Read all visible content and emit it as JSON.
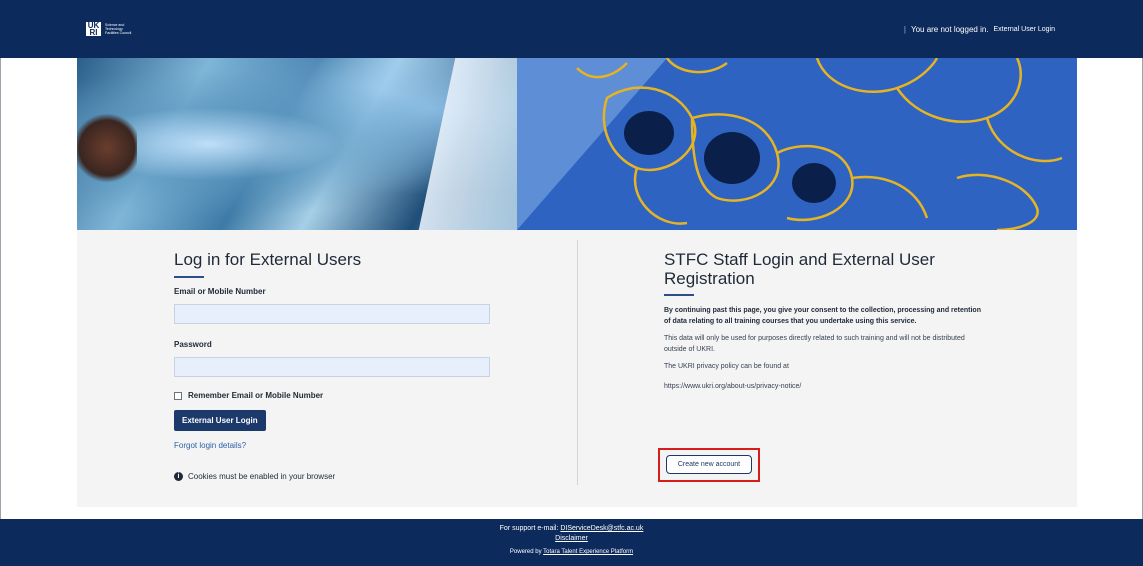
{
  "header": {
    "logo_mark": "UK RI",
    "logo_text": "Science and Technology Facilities Council",
    "separator": "|",
    "status_text": "You are not logged in.",
    "login_link": "External User Login"
  },
  "left": {
    "title": "Log in for External Users",
    "email_label": "Email or Mobile Number",
    "email_value": "",
    "password_label": "Password",
    "password_value": "",
    "remember_label": "Remember Email or Mobile Number",
    "login_button": "External User Login",
    "forgot_link": "Forgot login details?",
    "cookie_note": "Cookies must be enabled in your browser"
  },
  "right": {
    "title": "STFC Staff Login and External User Registration",
    "consent": "By continuing past this page, you give your consent to the collection, processing and retention of data relating to all training courses that you undertake using this service.",
    "para1": "This data will only be used for purposes directly related to such training and will not be distributed outside of UKRI.",
    "para2": "The UKRI privacy policy can be found at",
    "policy_url": "https://www.ukri.org/about-us/privacy-notice/",
    "create_button": "Create new account"
  },
  "footer": {
    "support_prefix": "For support e-mail:",
    "support_email": "DIServiceDesk@stfc.ac.uk",
    "disclaimer": "Disclaimer",
    "powered_prefix": "Powered by",
    "powered_link": "Totara Talent Experience Platform"
  },
  "colors": {
    "navbar": "#0d2a5c",
    "primary_button": "#1b3a6b",
    "highlight": "#d81b1b"
  }
}
